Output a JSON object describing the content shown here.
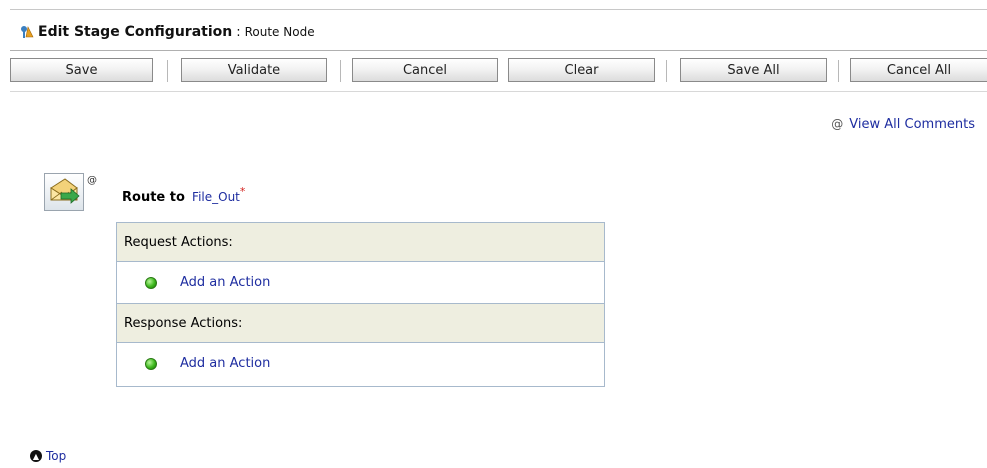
{
  "header": {
    "title": "Edit Stage Configuration",
    "separator": ":",
    "subtitle": "Route Node"
  },
  "toolbar": {
    "save_label": "Save",
    "validate_label": "Validate",
    "cancel_label": "Cancel",
    "clear_label": "Clear",
    "save_all_label": "Save All",
    "cancel_all_label": "Cancel All"
  },
  "comments": {
    "at_symbol": "@",
    "view_all_label": "View All Comments"
  },
  "node": {
    "comment_marker": "@",
    "route_label": "Route to",
    "target_link": "File_Out",
    "required_marker": "*"
  },
  "actions": {
    "request_header": "Request Actions:",
    "request_add_label": "Add an Action",
    "response_header": "Response Actions:",
    "response_add_label": "Add an Action"
  },
  "footer": {
    "top_label": "Top"
  },
  "icons": {
    "title": "stage-config-icon",
    "node": "route-envelope-icon",
    "action": "green-dot-icon",
    "top": "up-arrow-circle-icon"
  },
  "colors": {
    "link": "#1e2da0",
    "header_bg": "#eeeee0",
    "border": "#a7b9cc",
    "required": "#d4221e"
  }
}
